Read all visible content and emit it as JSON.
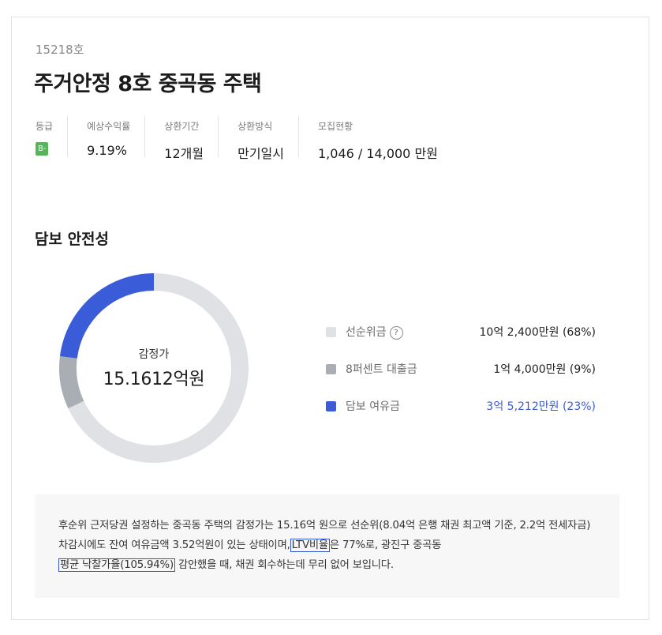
{
  "product": {
    "number": "15218호",
    "title": "주거안정 8호 중곡동 주택"
  },
  "summary": [
    {
      "label": "등급",
      "value": "B-"
    },
    {
      "label": "예상수익률",
      "value": "9.19%"
    },
    {
      "label": "상환기간",
      "value": "12개월"
    },
    {
      "label": "상환방식",
      "value": "만기일시"
    },
    {
      "label": "모집현황",
      "value": "1,046 / 14,000 만원"
    }
  ],
  "colors": {
    "grade_badge": "#58b45a",
    "senior": "#dfe1e5",
    "eight_percent": "#a9aeb5",
    "margin": "#3a5cd8"
  },
  "section": {
    "title": "담보 안전성"
  },
  "collateral": {
    "center_label": "감정가",
    "center_value": "15.1612억원",
    "legend": [
      {
        "label": "선순위금",
        "value": "10억 2,400만원 (68%)",
        "share": 68,
        "color": "#dfe1e5",
        "icon": "question-mark-circle-icon"
      },
      {
        "label": "8퍼센트 대출금",
        "value": "1억 4,000만원 (9%)",
        "share": 9,
        "color": "#a9aeb5"
      },
      {
        "label": "담보 여유금",
        "value": "3억 5,212만원 (23%)",
        "share": 23,
        "color": "#3a5cd8"
      }
    ],
    "help_glyph": "?"
  },
  "note": {
    "part1": "후순위 근저당권 설정하는 중곡동 주택의 감정가는 15.16억 원으로 선순위(8.04억 은행 채권 최고액 기준, 2.2억 전세자금) 차감시에도 잔여 여유금액 3.52억원이 있는 상태이며,",
    "highlight1": "LTV비율",
    "part2": "은 77%로, 광진구 중곡동",
    "highlight2": "평균 낙찰가율(105.94%)",
    "part3": " 감안했을 때, 채권 회수하는데 무리 없어 보입니다."
  }
}
